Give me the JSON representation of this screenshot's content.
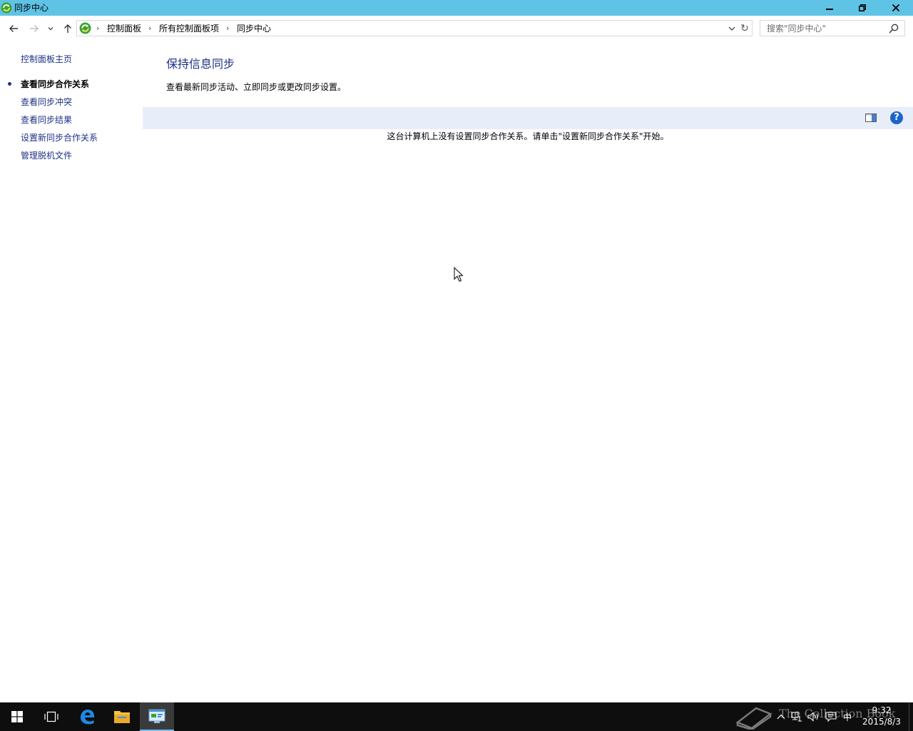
{
  "window": {
    "title": "同步中心",
    "minimize_icon": "minimize-icon",
    "maximize_icon": "restore-icon",
    "close_icon": "close-icon"
  },
  "navigation": {
    "breadcrumb": [
      "控制面板",
      "所有控制面板项",
      "同步中心"
    ],
    "separator": "›",
    "refresh_glyph": "↻",
    "search_placeholder": "搜索\"同步中心\""
  },
  "sidebar": {
    "items": [
      {
        "label": "控制面板主页",
        "active": false
      },
      {
        "label": "查看同步合作关系",
        "active": true
      },
      {
        "label": "查看同步冲突",
        "active": false
      },
      {
        "label": "查看同步结果",
        "active": false
      },
      {
        "label": "设置新同步合作关系",
        "active": false
      },
      {
        "label": "管理脱机文件",
        "active": false
      }
    ]
  },
  "main": {
    "heading": "保持信息同步",
    "description": "查看最新同步活动、立即同步或更改同步设置。",
    "help_glyph": "?",
    "empty_message": "这台计算机上没有设置同步合作关系。请单击\"设置新同步合作关系\"开始。"
  },
  "taskbar": {
    "apps": [
      "start-icon",
      "task-view-icon",
      "edge-icon",
      "file-explorer-icon",
      "control-panel-icon"
    ],
    "watermark": "The Collection Book",
    "tray_lang": "中",
    "time": "9:32",
    "date": "2015/8/3"
  },
  "colors": {
    "titlebar": "#5fc3e6",
    "link": "#1e3287",
    "toolbar": "#e8eef9",
    "taskbar": "#0e0e0e"
  }
}
